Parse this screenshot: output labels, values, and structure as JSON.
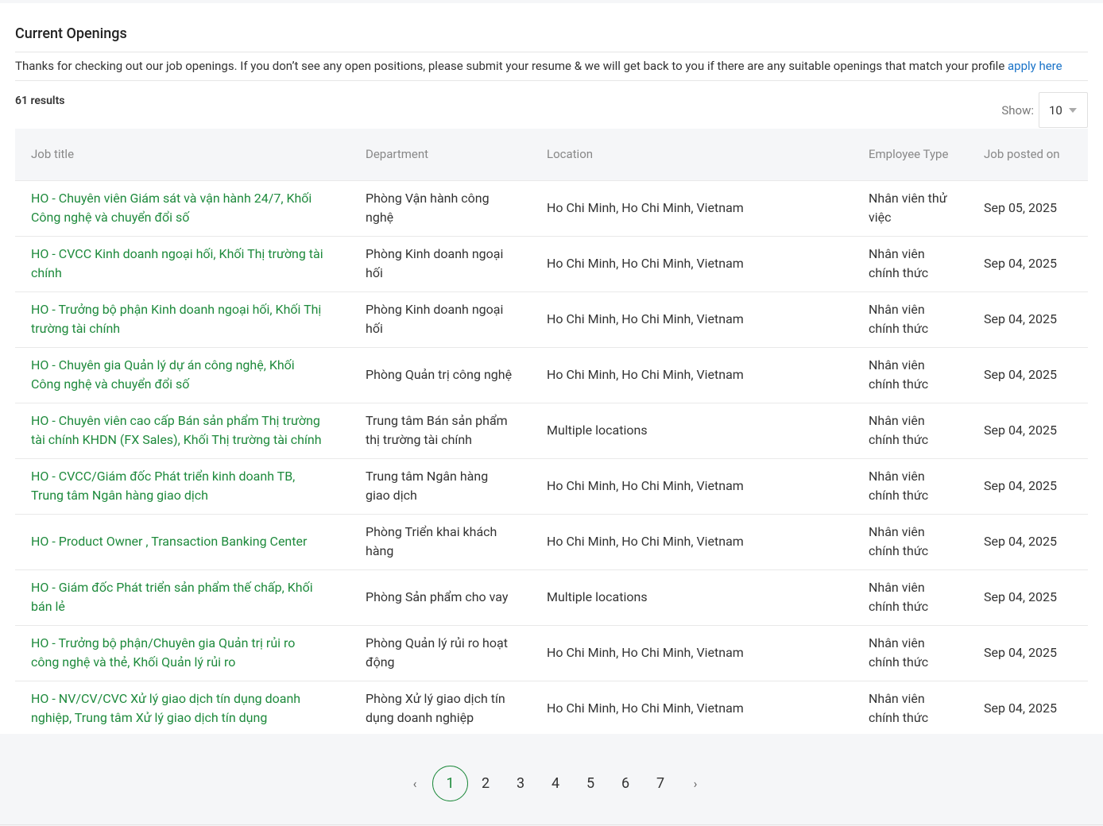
{
  "header": {
    "title": "Current Openings",
    "intro_text": "Thanks for checking out our job openings. If you don’t see any open positions, please submit your resume & we will get back to you if there are any suitable openings that match your profile ",
    "apply_link": "apply here"
  },
  "results": {
    "count_label": "61 results",
    "show_label": "Show:",
    "page_size": "10"
  },
  "table": {
    "columns": {
      "job_title": "Job title",
      "department": "Department",
      "location": "Location",
      "employee_type": "Employee Type",
      "posted_on": "Job posted on"
    },
    "rows": [
      {
        "title": "HO - Chuyên viên Giám sát và vận hành 24/7, Khối Công nghệ và chuyển đổi số",
        "department": "Phòng Vận hành công nghệ",
        "location": "Ho Chi Minh, Ho Chi Minh, Vietnam",
        "type": "Nhân viên thử việc",
        "posted": "Sep 05, 2025"
      },
      {
        "title": "HO - CVCC Kinh doanh ngoại hối, Khối Thị trường tài chính",
        "department": "Phòng Kinh doanh ngoại hối",
        "location": "Ho Chi Minh, Ho Chi Minh, Vietnam",
        "type": "Nhân viên chính thức",
        "posted": "Sep 04, 2025"
      },
      {
        "title": "HO - Trưởng bộ phận Kinh doanh ngoại hối, Khối Thị trường tài chính",
        "department": "Phòng Kinh doanh ngoại hối",
        "location": "Ho Chi Minh, Ho Chi Minh, Vietnam",
        "type": "Nhân viên chính thức",
        "posted": "Sep 04, 2025"
      },
      {
        "title": "HO - Chuyên gia Quản lý dự án công nghệ, Khối Công nghệ và chuyển đổi số",
        "department": "Phòng Quản trị công nghệ",
        "location": "Ho Chi Minh, Ho Chi Minh, Vietnam",
        "type": "Nhân viên chính thức",
        "posted": "Sep 04, 2025"
      },
      {
        "title": "HO - Chuyên viên cao cấp Bán sản phẩm Thị trường tài chính KHDN (FX Sales), Khối Thị trường tài chính",
        "department": "Trung tâm Bán sản phẩm thị trường tài chính",
        "location": "Multiple locations",
        "type": "Nhân viên chính thức",
        "posted": "Sep 04, 2025"
      },
      {
        "title": "HO - CVCC/Giám đốc Phát triển kinh doanh TB, Trung tâm Ngân hàng giao dịch",
        "department": "Trung tâm Ngân hàng giao dịch",
        "location": "Ho Chi Minh, Ho Chi Minh, Vietnam",
        "type": "Nhân viên chính thức",
        "posted": "Sep 04, 2025"
      },
      {
        "title": "HO - Product Owner , Transaction Banking Center",
        "department": "Phòng Triển khai khách hàng",
        "location": "Ho Chi Minh, Ho Chi Minh, Vietnam",
        "type": "Nhân viên chính thức",
        "posted": "Sep 04, 2025"
      },
      {
        "title": "HO - Giám đốc Phát triển sản phẩm thế chấp, Khối bán lẻ",
        "department": "Phòng Sản phẩm cho vay",
        "location": "Multiple locations",
        "type": "Nhân viên chính thức",
        "posted": "Sep 04, 2025"
      },
      {
        "title": "HO - Trưởng bộ phận/Chuyên gia Quản trị rủi ro công nghệ và thẻ, Khối Quản lý rủi ro",
        "department": "Phòng Quản lý rủi ro hoạt động",
        "location": "Ho Chi Minh, Ho Chi Minh, Vietnam",
        "type": "Nhân viên chính thức",
        "posted": "Sep 04, 2025"
      },
      {
        "title": "HO - NV/CV/CVC Xử lý giao dịch tín dụng doanh nghiệp, Trung tâm Xử lý giao dịch tín dụng",
        "department": "Phòng Xử lý giao dịch tín dụng doanh nghiệp",
        "location": "Ho Chi Minh, Ho Chi Minh, Vietnam",
        "type": "Nhân viên chính thức",
        "posted": "Sep 04, 2025"
      }
    ]
  },
  "pagination": {
    "prev": "‹",
    "next": "›",
    "pages": [
      "1",
      "2",
      "3",
      "4",
      "5",
      "6",
      "7"
    ],
    "current": "1"
  },
  "colors": {
    "accent_green": "#1e8a3c",
    "link_blue": "#1a73c8"
  }
}
